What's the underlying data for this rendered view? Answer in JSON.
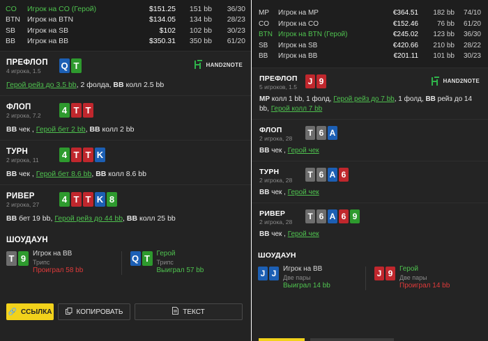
{
  "left": {
    "players": [
      {
        "pos": "CO",
        "name": "Игрок на CO (Герой)",
        "money": "$151.25",
        "bb": "151 bb",
        "stat": "36/30",
        "hero": true
      },
      {
        "pos": "BTN",
        "name": "Игрок на BTN",
        "money": "$134.05",
        "bb": "134 bb",
        "stat": "28/23",
        "hero": false
      },
      {
        "pos": "SB",
        "name": "Игрок на SB",
        "money": "$102",
        "bb": "102 bb",
        "stat": "30/23",
        "hero": false
      },
      {
        "pos": "BB",
        "name": "Игрок на BB",
        "money": "$350.31",
        "bb": "350 bb",
        "stat": "61/20",
        "hero": false
      }
    ],
    "logo_text": "HAND2NOTE",
    "streets": [
      {
        "name": "ПРЕФЛОП",
        "sub": "4 игрока, 1.5",
        "cards": [
          "Q",
          "T"
        ],
        "colors": [
          "blue",
          "green"
        ],
        "actions": [
          {
            "t": "Герой рейз до 3.5 bb",
            "h": true
          },
          {
            "t": ", 2 фолда, ",
            "h": false
          },
          {
            "t": "BB",
            "h": false,
            "b": true
          },
          {
            "t": " колл 2.5 bb",
            "h": false
          }
        ]
      },
      {
        "name": "ФЛОП",
        "sub": "2 игрока, 7.2",
        "cards": [
          "4",
          "T",
          "T"
        ],
        "colors": [
          "green",
          "red",
          "red"
        ],
        "actions": [
          {
            "t": "BB",
            "h": false,
            "b": true
          },
          {
            "t": " чек , ",
            "h": false
          },
          {
            "t": "Герой бет 2 bb",
            "h": true
          },
          {
            "t": ", ",
            "h": false
          },
          {
            "t": "BB",
            "h": false,
            "b": true
          },
          {
            "t": " колл 2 bb",
            "h": false
          }
        ]
      },
      {
        "name": "ТУРН",
        "sub": "2 игрока, 11",
        "cards": [
          "4",
          "T",
          "T",
          "K"
        ],
        "colors": [
          "green",
          "red",
          "red",
          "blue"
        ],
        "actions": [
          {
            "t": "BB",
            "h": false,
            "b": true
          },
          {
            "t": " чек , ",
            "h": false
          },
          {
            "t": "Герой бет 8.6 bb",
            "h": true
          },
          {
            "t": ", ",
            "h": false
          },
          {
            "t": "BB",
            "h": false,
            "b": true
          },
          {
            "t": " колл 8.6 bb",
            "h": false
          }
        ]
      },
      {
        "name": "РИВЕР",
        "sub": "2 игрока, 27",
        "cards": [
          "4",
          "T",
          "T",
          "K",
          "8"
        ],
        "colors": [
          "green",
          "red",
          "red",
          "blue",
          "green"
        ],
        "actions": [
          {
            "t": "BB",
            "h": false,
            "b": true
          },
          {
            "t": " бет 19 bb, ",
            "h": false
          },
          {
            "t": "Герой рейз до 44 bb",
            "h": true
          },
          {
            "t": ", ",
            "h": false
          },
          {
            "t": "BB",
            "h": false,
            "b": true
          },
          {
            "t": " колл 25 bb",
            "h": false
          }
        ]
      }
    ],
    "showdown": {
      "title": "ШОУДАУН",
      "p1": {
        "cards": [
          "T",
          "9"
        ],
        "colors": [
          "gray",
          "green"
        ],
        "name": "Игрок на BB",
        "hand": "Трипс",
        "result": "Проиграл 58 bb"
      },
      "p2": {
        "cards": [
          "Q",
          "T"
        ],
        "colors": [
          "blue",
          "green"
        ],
        "name": "Герой",
        "hand": "Трипс",
        "result": "Выиграл 57 bb"
      }
    },
    "buttons": {
      "link": "ССЫЛКА",
      "copy": "КОПИРОВАТЬ",
      "text": "ТЕКСТ"
    }
  },
  "right": {
    "players": [
      {
        "pos": "MP",
        "name": "Игрок на MP",
        "money": "€364.51",
        "bb": "182 bb",
        "stat": "74/10",
        "hero": false
      },
      {
        "pos": "CO",
        "name": "Игрок на CO",
        "money": "€152.46",
        "bb": "76 bb",
        "stat": "61/20",
        "hero": false
      },
      {
        "pos": "BTN",
        "name": "Игрок на BTN (Герой)",
        "money": "€245.02",
        "bb": "123 bb",
        "stat": "36/30",
        "hero": true
      },
      {
        "pos": "SB",
        "name": "Игрок на SB",
        "money": "€420.66",
        "bb": "210 bb",
        "stat": "28/22",
        "hero": false
      },
      {
        "pos": "BB",
        "name": "Игрок на BB",
        "money": "€201.11",
        "bb": "101 bb",
        "stat": "30/23",
        "hero": false
      }
    ],
    "logo_text": "HAND2NOTE",
    "streets": [
      {
        "name": "ПРЕФЛОП",
        "sub": "5 игроков, 1.5",
        "cards": [
          "J",
          "9"
        ],
        "colors": [
          "red",
          "red"
        ],
        "actions": [
          {
            "t": "MP",
            "h": false,
            "b": true
          },
          {
            "t": " колл 1 bb, 1 фолд, ",
            "h": false
          },
          {
            "t": "Герой рейз до 7 bb",
            "h": true
          },
          {
            "t": ", 1 фолд, ",
            "h": false
          },
          {
            "t": "BB",
            "h": false,
            "b": true
          },
          {
            "t": " рейз до 14 bb, ",
            "h": false
          },
          {
            "t": "Герой колл 7 bb",
            "h": true
          }
        ]
      },
      {
        "name": "ФЛОП",
        "sub": "2 игрока, 28",
        "cards": [
          "T",
          "6",
          "A"
        ],
        "colors": [
          "gray",
          "gray",
          "blue"
        ],
        "actions": [
          {
            "t": "BB",
            "h": false,
            "b": true
          },
          {
            "t": " чек , ",
            "h": false
          },
          {
            "t": "Герой чек",
            "h": true
          }
        ]
      },
      {
        "name": "ТУРН",
        "sub": "2 игрока, 28",
        "cards": [
          "T",
          "6",
          "A",
          "6"
        ],
        "colors": [
          "gray",
          "gray",
          "blue",
          "red"
        ],
        "actions": [
          {
            "t": "BB",
            "h": false,
            "b": true
          },
          {
            "t": " чек , ",
            "h": false
          },
          {
            "t": "Герой чек",
            "h": true
          }
        ]
      },
      {
        "name": "РИВЕР",
        "sub": "2 игрока, 28",
        "cards": [
          "T",
          "6",
          "A",
          "6",
          "9"
        ],
        "colors": [
          "gray",
          "gray",
          "blue",
          "red",
          "green"
        ],
        "actions": [
          {
            "t": "BB",
            "h": false,
            "b": true
          },
          {
            "t": " чек , ",
            "h": false
          },
          {
            "t": "Герой чек",
            "h": true
          }
        ]
      }
    ],
    "showdown": {
      "title": "ШОУДАУН",
      "p1": {
        "cards": [
          "J",
          "J"
        ],
        "colors": [
          "blue",
          "blue"
        ],
        "name": "Игрок на BB",
        "hand": "Две пары",
        "result": "Выиграл 14 bb"
      },
      "p2": {
        "cards": [
          "J",
          "9"
        ],
        "colors": [
          "red",
          "red"
        ],
        "name": "Герой",
        "hand": "Две пары",
        "result": "Проиграл 14 bb"
      }
    }
  },
  "colors": {
    "hero": "#4fc34f",
    "lose": "#e03a3a",
    "accent": "#f2d21b",
    "card_blue": "#1c5fb4",
    "card_green": "#2e9a2e",
    "card_red": "#c0272d",
    "card_gray": "#6d6d6d"
  }
}
